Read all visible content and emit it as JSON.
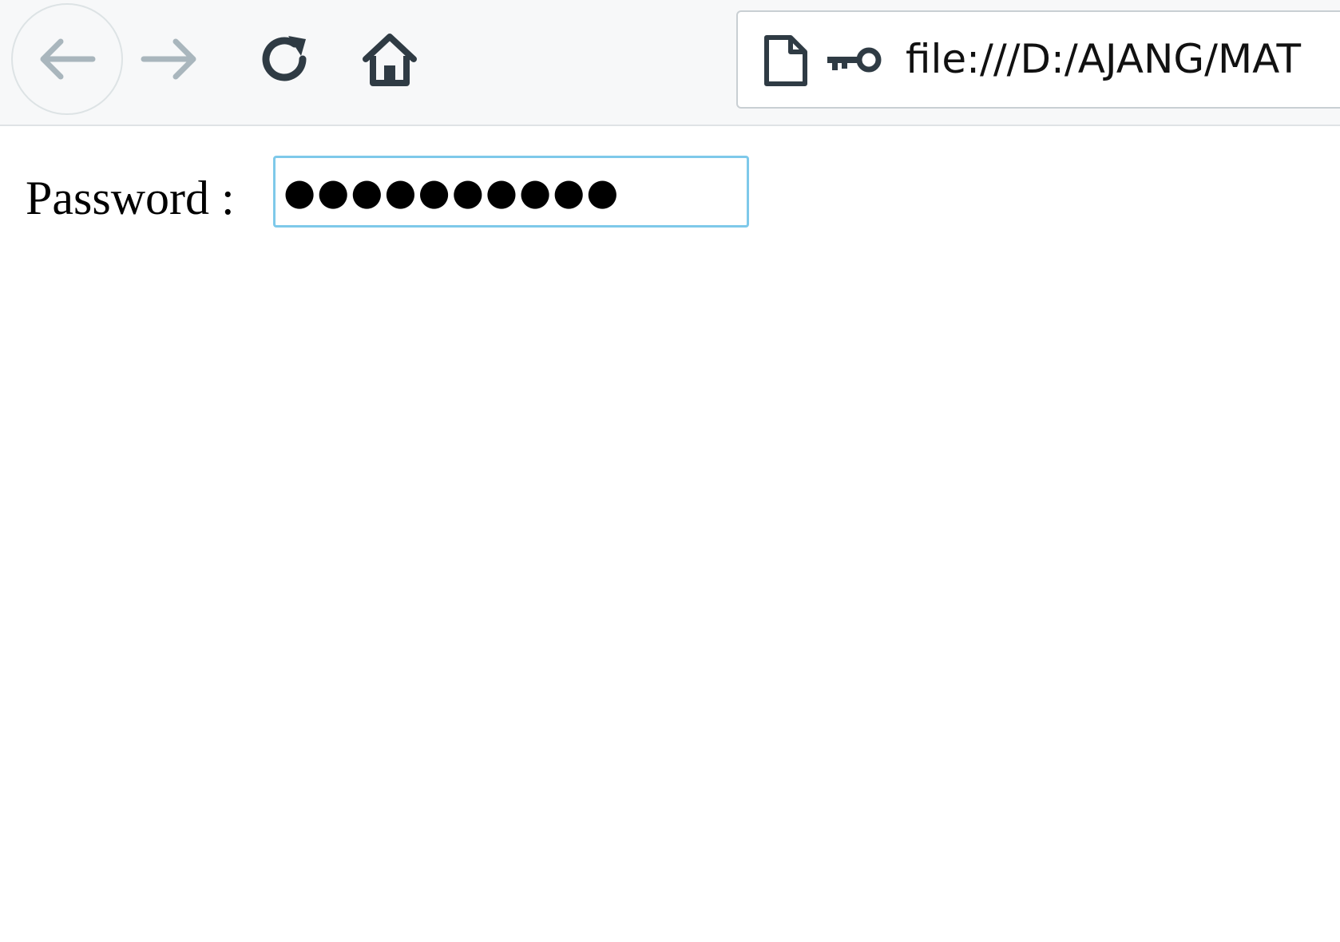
{
  "browser": {
    "address_bar": {
      "url": "file:///D:/AJANG/MAT"
    },
    "icons": {
      "back": "arrow-left-icon",
      "forward": "arrow-right-icon",
      "reload": "reload-icon",
      "home": "home-icon",
      "page": "page-icon",
      "key": "key-icon"
    },
    "colors": {
      "toolbar_bg": "#f7f8f9",
      "icon_dark": "#2f3b44",
      "icon_disabled": "#a9b6bd",
      "focus_border": "#7ec9ea"
    }
  },
  "page": {
    "password_label": "Password :",
    "password_value": "●●●●●●●●●●"
  }
}
